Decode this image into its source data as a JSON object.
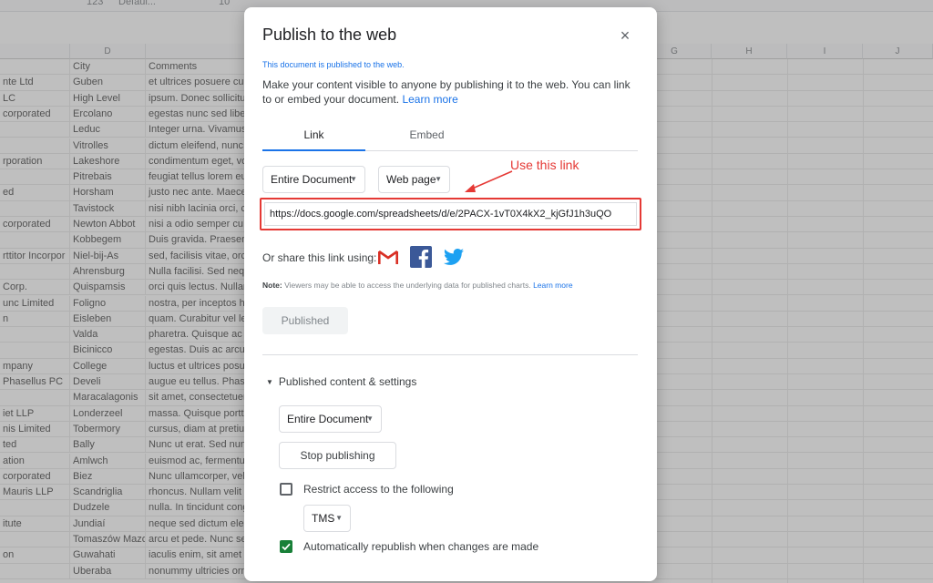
{
  "toolbar": {
    "font_label": "Defaul...",
    "font_size": "10",
    "number_format": "123"
  },
  "sheet": {
    "columns": [
      "D",
      "G",
      "H",
      "I",
      "J"
    ],
    "header_row": [
      "",
      "City",
      "Comments"
    ],
    "rows": [
      [
        "nte Ltd",
        "Guben",
        "et ultrices posuere cu"
      ],
      [
        "LC",
        "High Level",
        "ipsum. Donec sollicitu"
      ],
      [
        "corporated",
        "Ercolano",
        "egestas nunc sed libe"
      ],
      [
        "",
        "Leduc",
        "Integer urna. Vivamus"
      ],
      [
        "",
        "Vitrolles",
        "dictum eleifend, nunc"
      ],
      [
        "rporation",
        "Lakeshore",
        "condimentum eget, vo"
      ],
      [
        "",
        "Pitrebais",
        "feugiat tellus lorem eu"
      ],
      [
        "ed",
        "Horsham",
        "justo nec ante. Maece"
      ],
      [
        "",
        "Tavistock",
        "nisi nibh lacinia orci, c"
      ],
      [
        "corporated",
        "Newton Abbot",
        "nisi a odio semper cu"
      ],
      [
        "",
        "Kobbegem",
        "Duis gravida. Praeser"
      ],
      [
        "rttitor Incorpor",
        "Niel-bij-As",
        "sed, facilisis vitae, orc"
      ],
      [
        "",
        "Ahrensburg",
        "Nulla facilisi. Sed neq"
      ],
      [
        "Corp.",
        "Quispamsis",
        "orci quis lectus. Nullan"
      ],
      [
        "unc Limited",
        "Foligno",
        "nostra, per inceptos h"
      ],
      [
        "n",
        "Eisleben",
        "quam. Curabitur vel le"
      ],
      [
        "",
        "Valda",
        "pharetra. Quisque ac"
      ],
      [
        "",
        "Bicinicco",
        "egestas. Duis ac arcu"
      ],
      [
        "mpany",
        "College",
        "luctus et ultrices posu"
      ],
      [
        "Phasellus PC",
        "Develi",
        "augue eu tellus. Phas"
      ],
      [
        "",
        "Maracalagonis",
        "sit amet, consectetuer"
      ],
      [
        "iet LLP",
        "Londerzeel",
        "massa. Quisque portt"
      ],
      [
        "nis Limited",
        "Tobermory",
        "cursus, diam at pretiu"
      ],
      [
        "ted",
        "Bally",
        "Nunc ut erat. Sed nun"
      ],
      [
        "ation",
        "Amlwch",
        "euismod ac, fermentu"
      ],
      [
        "corporated",
        "Biez",
        "Nunc ullamcorper, vel"
      ],
      [
        "Mauris LLP",
        "Scandriglia",
        "rhoncus. Nullam velit"
      ],
      [
        "",
        "Dudzele",
        "nulla. In tincidunt cong"
      ],
      [
        "itute",
        "Jundiaí",
        "neque sed dictum ele"
      ],
      [
        "",
        "Tomaszów Mazo",
        "arcu et pede. Nunc se"
      ],
      [
        "on",
        "Guwahati",
        "iaculis enim, sit amet"
      ],
      [
        "",
        "Uberaba",
        "nonummy ultricies orn"
      ]
    ]
  },
  "dialog": {
    "title": "Publish to the web",
    "close_glyph": "×",
    "status_note": "This document is published to the web.",
    "description": "Make your content visible to anyone by publishing it to the web. You can link to or embed your document.",
    "learn_more": "Learn more",
    "tabs": [
      {
        "label": "Link",
        "active": true
      },
      {
        "label": "Embed",
        "active": false
      }
    ],
    "scope_select": "Entire Document",
    "format_select": "Web page",
    "annotation": "Use this link",
    "annotation_color": "#e53935",
    "url_value": "https://docs.google.com/spreadsheets/d/e/2PACX-1vT0X4kX2_kjGfJ1h3uQO",
    "share_label": "Or share this link using:",
    "share_icons": [
      "gmail-icon",
      "facebook-icon",
      "twitter-icon"
    ],
    "note_bold": "Note:",
    "note_text": "Viewers may be able to access the underlying data for published charts.",
    "note_link": "Learn more",
    "published_button": "Published",
    "settings_header": "Published content & settings",
    "settings_scope_select": "Entire Document",
    "stop_button": "Stop publishing",
    "restrict_label": "Restrict access to the following",
    "restrict_checked": false,
    "domain_select": "TMS",
    "auto_label": "Automatically republish when changes are made",
    "auto_checked": true,
    "accent_color": "#1a73e8",
    "check_color": "#188038"
  }
}
